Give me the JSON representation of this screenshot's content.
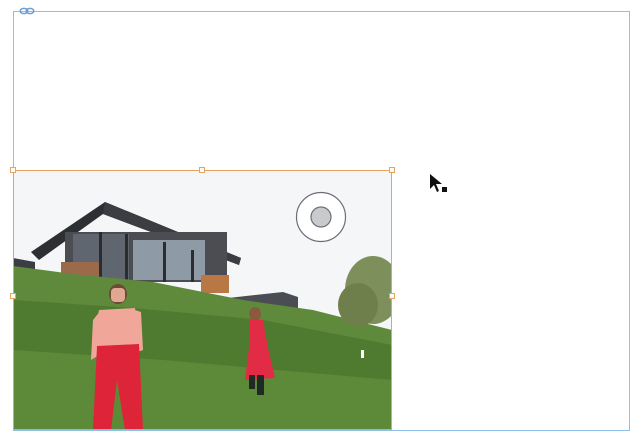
{
  "editor": {
    "frame_color": "#8ec0e8",
    "selection_color": "#e8a35c",
    "icons": {
      "frame_link": "chain-link-icon",
      "grabber": "content-grabber-icon",
      "cursor": "arrow-pointer-icon"
    }
  },
  "image": {
    "subject": "photo"
  }
}
